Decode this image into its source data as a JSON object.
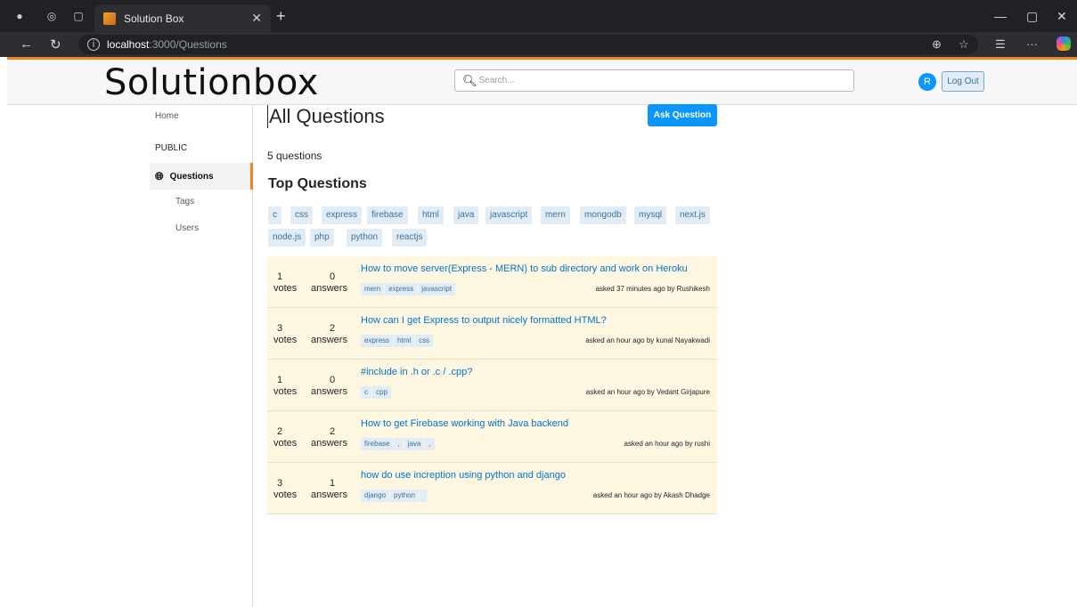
{
  "browser": {
    "tab_title": "Solution Box",
    "url_host": "localhost",
    "url_path": ":3000/Questions"
  },
  "header": {
    "logo": "Solutionbox",
    "search_placeholder": "Search...",
    "avatar_initial": "R",
    "logout_label": "Log Out"
  },
  "sidebar": {
    "home": "Home",
    "public": "PUBLIC",
    "questions": "Questions",
    "tags": "Tags",
    "users": "Users"
  },
  "main": {
    "title": "All Questions",
    "ask_button": "Ask Question",
    "count": "5 questions",
    "section_title": "Top Questions",
    "tag_cloud": [
      "c",
      "css",
      "express",
      "firebase",
      "html",
      "java",
      "javascript",
      "mern",
      "mongodb",
      "mysql",
      "next.js",
      "node.js",
      "php",
      "python",
      "reactjs"
    ],
    "questions": [
      {
        "votes": "1",
        "votes_label": "votes",
        "answers": "0",
        "answers_label": "answers",
        "title": "How to move server(Express - MERN) to sub directory and work on Heroku",
        "tags": [
          "mern",
          "express",
          "javascript"
        ],
        "meta": "asked 37 minutes ago by Rushikesh"
      },
      {
        "votes": "3",
        "votes_label": "votes",
        "answers": "2",
        "answers_label": "answers",
        "title": "How can I get Express to output nicely formatted HTML?",
        "tags": [
          "express",
          "html",
          "css"
        ],
        "meta": "asked an hour ago by kunal Nayakwadi"
      },
      {
        "votes": "1",
        "votes_label": "votes",
        "answers": "0",
        "answers_label": "answers",
        "title": "#include in .h or .c / .cpp?",
        "tags": [
          "c",
          "cpp"
        ],
        "meta": "asked an hour ago by Vedant Girjapure"
      },
      {
        "votes": "2",
        "votes_label": "votes",
        "answers": "2",
        "answers_label": "answers",
        "title": "How to get Firebase working with Java backend",
        "tags": [
          "firebase",
          ",",
          "java",
          ","
        ],
        "meta": "asked an hour ago by rushi"
      },
      {
        "votes": "3",
        "votes_label": "votes",
        "answers": "1",
        "answers_label": "answers",
        "title": "how do use increption using python and django",
        "tags": [
          "django",
          "python",
          ""
        ],
        "meta": "asked an hour ago by Akash Dhadge"
      }
    ]
  },
  "colors": {
    "accent": "#f48024",
    "primary_button": "#0a95ff",
    "tag_bg": "#e1ecf4",
    "tag_text": "#39739d",
    "question_bg": "#fdf7e2"
  }
}
